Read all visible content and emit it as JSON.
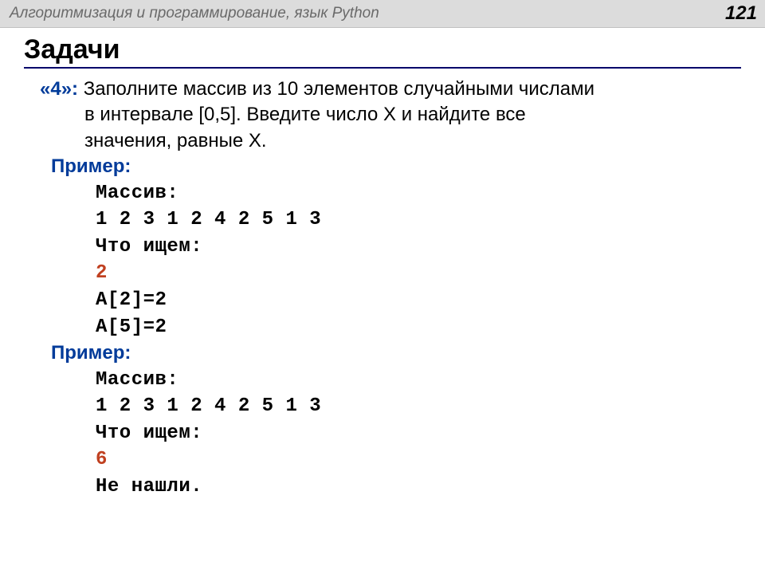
{
  "header": {
    "title": "Алгоритмизация и программирование, язык Python",
    "page": "121"
  },
  "section_title": "Задачи",
  "grade": "«4»:",
  "task_l1": "Заполните массив из 10 элементов случайными числами",
  "task_l2": "в интервале [0,5]. Введите число X и найдите все",
  "task_l3": "значения, равные X.",
  "example_label": "Пример:",
  "ex1": {
    "arr_label": "Массив:",
    "arr": "1 2 3 1 2 4 2 5 1 3",
    "search_label": "Что ищем:",
    "search_val": "2",
    "r1": "A[2]=2",
    "r2": "A[5]=2"
  },
  "ex2": {
    "arr_label": "Массив:",
    "arr": "1 2 3 1 2 4 2 5 1 3",
    "search_label": "Что ищем:",
    "search_val": "6",
    "notfound": "Не нашли."
  }
}
